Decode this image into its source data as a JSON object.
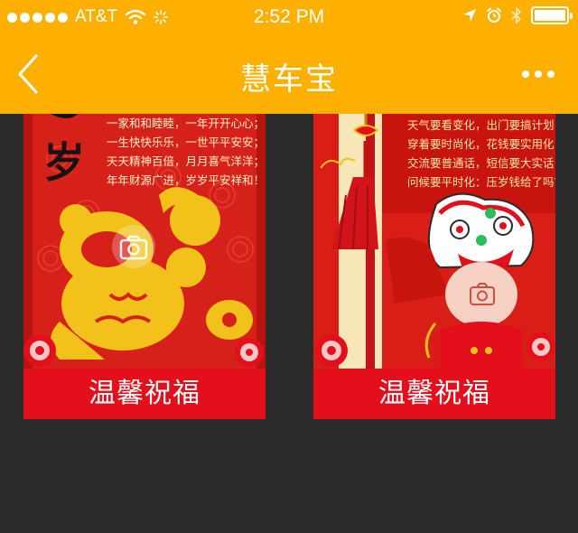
{
  "status_bar": {
    "carrier": "AT&T",
    "time": "2:52 PM"
  },
  "nav": {
    "title": "慧车宝"
  },
  "cards": [
    {
      "label": "温馨祝福",
      "poem": [
        "一家和和睦睦，一年开开心心；",
        "一生快快乐乐，一世平平安安；",
        "天天精神百倍，月月喜气洋洋；",
        "年年财源广进，岁岁平安祥和！"
      ],
      "art_char": "岁"
    },
    {
      "label": "温馨祝福",
      "poem": [
        "天气要看变化，出门要搞计划，",
        "穿着要时尚化，花钱要实用化，",
        "交流要普通话，短信要大实话，",
        "问候要平时化：压岁钱给了吗？"
      ]
    }
  ],
  "colors": {
    "header": "#fdb000",
    "card_bar": "#e3101c",
    "background": "#2b2b2b"
  }
}
